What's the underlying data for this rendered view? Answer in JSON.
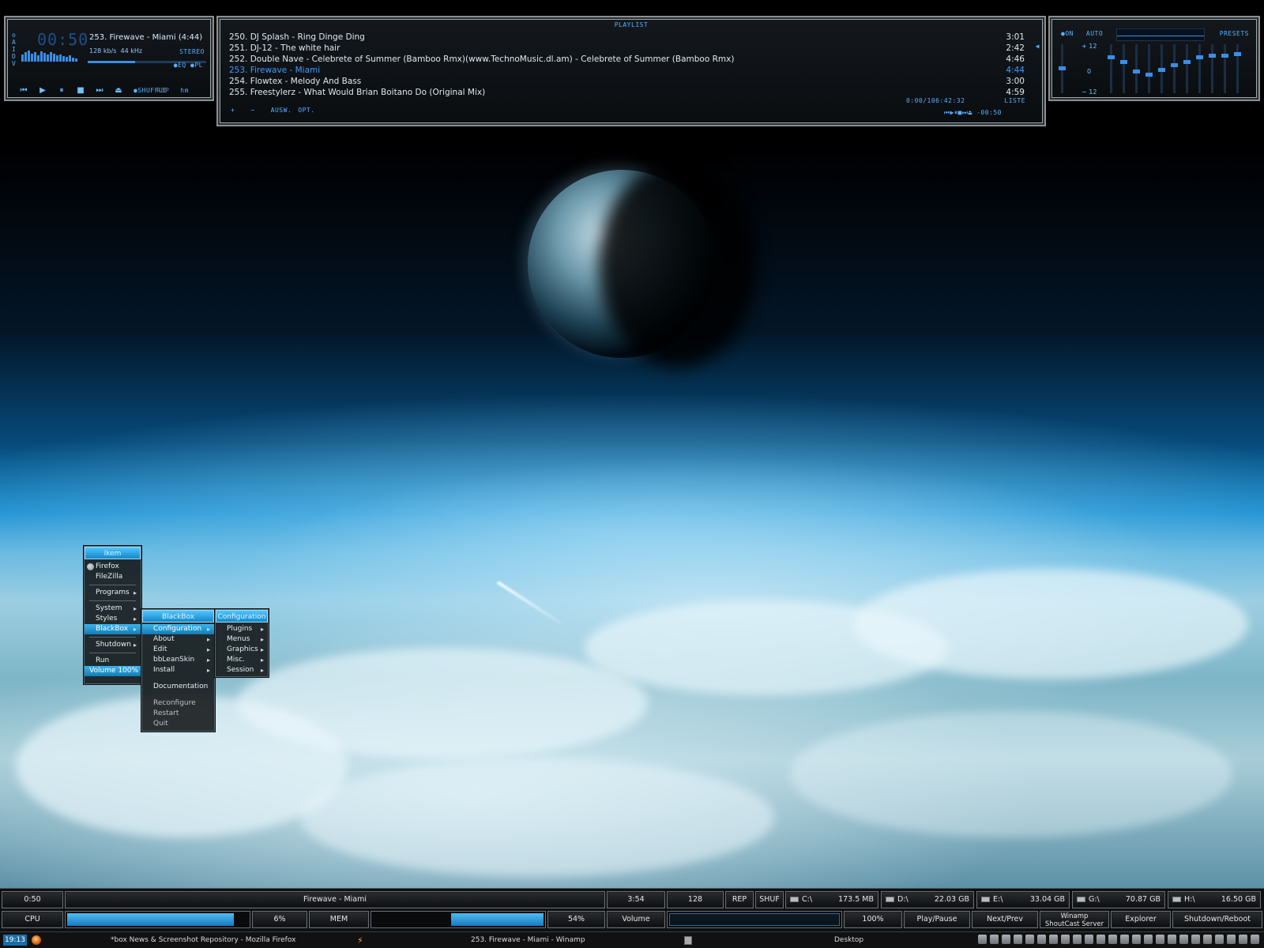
{
  "winamp": {
    "main": {
      "time": "00:50",
      "title": "253. Firewave - Miami (4:44)",
      "bitrate": "128 kb/s",
      "samplerate": "44 kHz",
      "stereo": "STEREO",
      "eq": "EQ",
      "pl": "PL",
      "shuffle": "SHUFFLE",
      "rep": "REP",
      "ctrl_prev": "⏮",
      "ctrl_play": "▶",
      "ctrl_pause": "⏸",
      "ctrl_stop": "■",
      "ctrl_next": "⏭",
      "ctrl_eject": "⏏",
      "logo": "hm"
    },
    "playlist": {
      "title": "PLAYLIST",
      "rows": [
        {
          "name": "250. DJ Splash - Ring Dinge Ding",
          "length": "3:01"
        },
        {
          "name": "251. DJ-12 - The white hair",
          "length": "2:42"
        },
        {
          "name": "252. Double Nave - Celebrete of Summer (Bamboo Rmx)(www.TechnoMusic.dl.am) - Celebrete of Summer (Bamboo Rmx)",
          "length": "4:46"
        },
        {
          "name": "253. Firewave - Miami",
          "length": "4:44"
        },
        {
          "name": "254. Flowtex  - Melody And Bass",
          "length": "3:00"
        },
        {
          "name": "255. Freestylerz - What Would Brian Boitano Do (Original Mix)",
          "length": "4:59"
        }
      ],
      "add": "+",
      "remove": "−",
      "select": "AUSW.",
      "options": "OPT.",
      "total": "0:00/106:42:32",
      "list": "LISTE",
      "mini_time": "-00:50"
    },
    "eq": {
      "on": "ON",
      "auto": "AUTO",
      "presets": "PRESETS",
      "plus12": "+ 12",
      "zero": "0",
      "minus12": "− 12"
    }
  },
  "menus": {
    "root": {
      "title": "Ikem",
      "items": [
        "Firefox",
        "FileZilla",
        "Programs",
        "System",
        "Styles",
        "BlackBox",
        "Shutdown",
        "Run",
        "Volume 100%"
      ]
    },
    "blackbox": {
      "title": "BlackBox",
      "items": [
        "Configuration",
        "About",
        "Edit",
        "bbLeanSkin",
        "Install",
        "Documentation",
        "Reconfigure",
        "Restart",
        "Quit"
      ]
    },
    "configuration": {
      "title": "Configuration",
      "items": [
        "Plugins",
        "Menus",
        "Graphics",
        "Misc.",
        "Session"
      ]
    }
  },
  "bar": {
    "elapsed": "0:50",
    "track": "Firewave - Miami",
    "length": "3:54",
    "bitrate": "128",
    "rep": "REP",
    "shuf": "SHUF",
    "drives": [
      {
        "label": "C:\\",
        "free": "173.5 MB"
      },
      {
        "label": "D:\\",
        "free": "22.03 GB"
      },
      {
        "label": "E:\\",
        "free": "33.04 GB"
      },
      {
        "label": "G:\\",
        "free": "70.87 GB"
      },
      {
        "label": "H:\\",
        "free": "16.50 GB"
      }
    ],
    "cpu_label": "CPU",
    "cpu_value": "6%",
    "cpu_fraction": 0.06,
    "mem_label": "MEM",
    "mem_value": "54%",
    "mem_fraction": 0.54,
    "volume_label": "Volume",
    "volume_value": "100%",
    "volume_fraction": 1.0,
    "play_pause": "Play/Pause",
    "next_prev": "Next/Prev",
    "winamp_label": "Winamp",
    "shoutcast_label": "ShoutCast Server",
    "explorer": "Explorer",
    "shutdown": "Shutdown/Reboot"
  },
  "taskbar": {
    "clock": "19:13",
    "tasks": [
      "*box News & Screenshot Repository - Mozilla Firefox",
      "253. Firewave - Miami - Winamp",
      "Desktop"
    ]
  },
  "colors": {
    "accent": "#3e9bff",
    "menu_highlight": "#1f95d6",
    "meter_fill": "#2f9de0"
  }
}
